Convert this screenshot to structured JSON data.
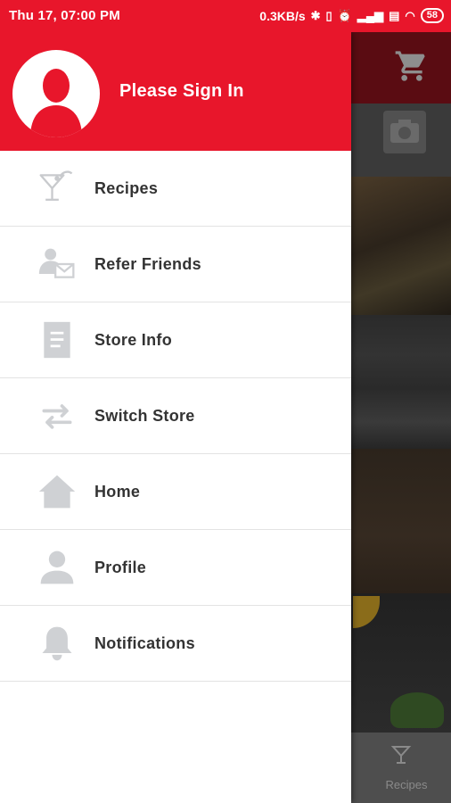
{
  "status_bar": {
    "time": "Thu 17, 07:00 PM",
    "speed": "0.3KB/s",
    "battery": "58"
  },
  "drawer": {
    "sign_in": "Please Sign In",
    "items": [
      {
        "label": "Recipes",
        "icon": "cocktail-icon"
      },
      {
        "label": "Refer Friends",
        "icon": "refer-friends-icon"
      },
      {
        "label": "Store Info",
        "icon": "document-icon"
      },
      {
        "label": "Switch Store",
        "icon": "swap-arrows-icon"
      },
      {
        "label": "Home",
        "icon": "home-icon"
      },
      {
        "label": "Profile",
        "icon": "person-icon"
      },
      {
        "label": "Notifications",
        "icon": "bell-icon"
      }
    ]
  },
  "background_app": {
    "bottom_tab_label": "Recipes"
  },
  "colors": {
    "brand_red": "#e8162b",
    "icon_gray": "#cfd1d4",
    "text_dark": "#333333"
  }
}
